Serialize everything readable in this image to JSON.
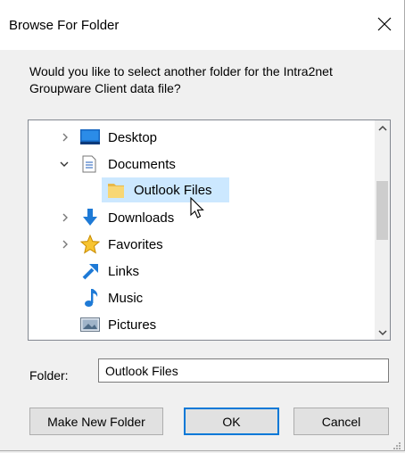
{
  "dialog": {
    "title": "Browse For Folder",
    "prompt": "Would you like to select another folder for the Intra2net Groupware Client data file?"
  },
  "tree": {
    "items": [
      {
        "label": "Desktop",
        "icon": "desktop-icon",
        "expander": "collapsed"
      },
      {
        "label": "Documents",
        "icon": "documents-icon",
        "expander": "expanded"
      },
      {
        "label": "Outlook Files",
        "icon": "folder-icon",
        "expander": "none",
        "selected": true
      },
      {
        "label": "Downloads",
        "icon": "downloads-icon",
        "expander": "collapsed"
      },
      {
        "label": "Favorites",
        "icon": "favorites-star-icon",
        "expander": "collapsed"
      },
      {
        "label": "Links",
        "icon": "links-icon",
        "expander": "none"
      },
      {
        "label": "Music",
        "icon": "music-note-icon",
        "expander": "none"
      },
      {
        "label": "Pictures",
        "icon": "pictures-icon",
        "expander": "none"
      }
    ]
  },
  "folder": {
    "label": "Folder:",
    "value": "Outlook Files"
  },
  "buttons": {
    "make_new_folder": "Make New Folder",
    "ok": "OK",
    "cancel": "Cancel"
  },
  "colors": {
    "selection": "#cce8ff",
    "default_button_border": "#0078d7",
    "folder_yellow": "#f8d775",
    "accent_blue": "#1e7ad6"
  }
}
